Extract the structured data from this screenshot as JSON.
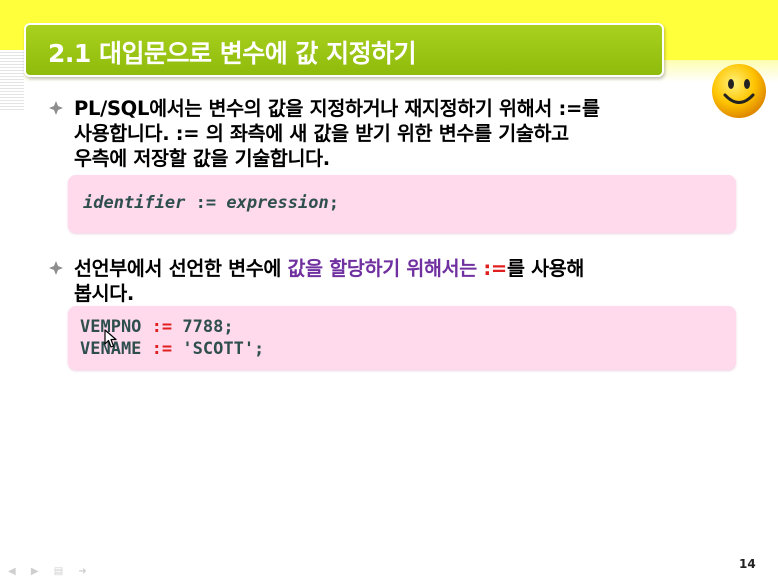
{
  "slide": {
    "title": "2.1 대입문으로 변수에 값 지정하기",
    "page_number": "14"
  },
  "bullet1": {
    "line1": "PL/SQL에서는 변수의 값을 지정하거나 재지정하기 위해서 :=를",
    "line2": "사용합니다. := 의 좌측에 새 값을 받기 위한 변수를 기술하고",
    "line3": "우측에 저장할 값을 기술합니다."
  },
  "syntax_box": {
    "identifier": "identifier",
    "operator": ":=",
    "expression": "expression",
    "terminator": ";"
  },
  "bullet2": {
    "part1": "선언부에서 선언한 변수에 ",
    "highlight1": "값을 할당하기 위해서는 ",
    "highlight2": ":=",
    "part2": "를 사용해",
    "line2": "봅시다."
  },
  "example_box": {
    "line1_var": "VEMPNO",
    "line1_op": ":=",
    "line1_val": "7788;",
    "line2_var": "VENAME",
    "line2_op": ":=",
    "line2_val": "'SCOTT';"
  },
  "icons": {
    "bullet": "diamond-bullet-icon",
    "smiley": "smiley-face-icon",
    "cursor": "mouse-cursor-icon"
  },
  "colors": {
    "title_bar": "#99c414",
    "top_band": "#ffff3c",
    "code_box": "#ffd9ec",
    "highlight_purple": "#7030a0",
    "operator_red": "#e02020"
  }
}
